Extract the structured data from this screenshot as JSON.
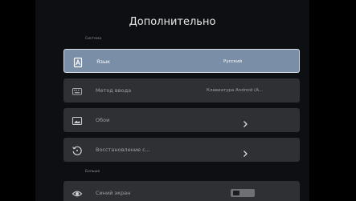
{
  "header": {
    "title": "Дополнительно"
  },
  "sections": {
    "system_label": "Система",
    "other_label": "Больше"
  },
  "rows": [
    {
      "label": "Язык",
      "value": "Русский",
      "icon": "language-icon",
      "selected": true
    },
    {
      "label": "Метод ввода",
      "value": "Клавиатура Android (A...",
      "icon": "keyboard-icon",
      "selected": false
    },
    {
      "label": "Обои",
      "value": "",
      "icon": "wallpaper-icon",
      "selected": false
    },
    {
      "label": "Восстановление с...",
      "value": "",
      "icon": "restore-icon",
      "selected": false
    },
    {
      "label": "Синий экран",
      "value": "",
      "icon": "eye-icon",
      "selected": false
    }
  ],
  "blue_screen_toggle": {
    "state": "off"
  },
  "colors": {
    "background": "#0e0f12",
    "row": "#2e3033",
    "row_selected": "#7a8ea7"
  }
}
